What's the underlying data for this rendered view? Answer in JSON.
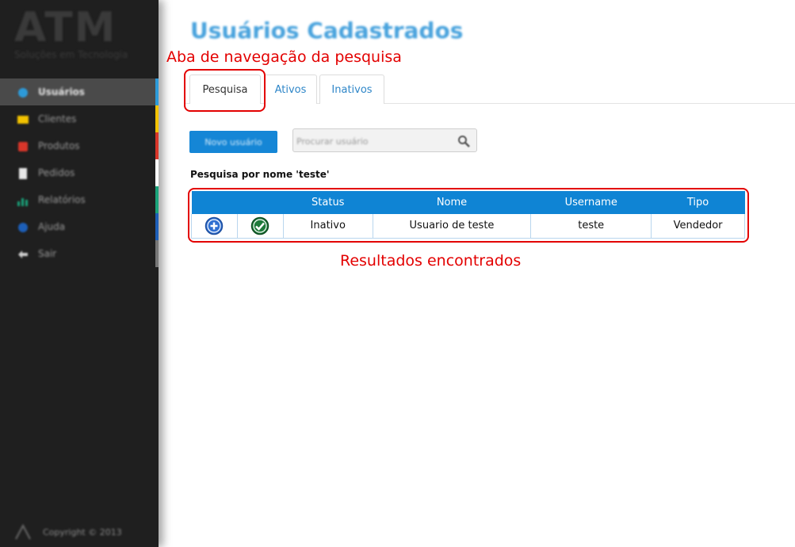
{
  "sidebar": {
    "logo": {
      "main": "ATM",
      "sub": "Soluções em Tecnologia"
    },
    "items": [
      {
        "label": "Usuários",
        "icon": "user-icon",
        "color": "#2d9ad9",
        "active": true
      },
      {
        "label": "Clientes",
        "icon": "card-icon",
        "color": "#f2c200",
        "active": false
      },
      {
        "label": "Produtos",
        "icon": "box-icon",
        "color": "#d9362a",
        "active": false
      },
      {
        "label": "Pedidos",
        "icon": "document-icon",
        "color": "#ffffff",
        "active": false
      },
      {
        "label": "Relatórios",
        "icon": "chart-icon",
        "color": "#1aa37a",
        "active": false
      },
      {
        "label": "Ajuda",
        "icon": "help-icon",
        "color": "#1d5fb8",
        "active": false
      },
      {
        "label": "Sair",
        "icon": "exit-icon",
        "color": "#777777",
        "active": false
      }
    ],
    "footer": "Copyright © 2013"
  },
  "main": {
    "title": "Usuários Cadastrados",
    "tabs": [
      {
        "label": "Pesquisa",
        "active": true
      },
      {
        "label": "Ativos",
        "active": false
      },
      {
        "label": "Inativos",
        "active": false
      }
    ],
    "new_user_button": "Novo usuário",
    "search": {
      "placeholder": "Procurar usuário"
    },
    "search_label": "Pesquisa por nome 'teste'",
    "table": {
      "headers": [
        "",
        "",
        "Status",
        "Nome",
        "Username",
        "Tipo"
      ],
      "rows": [
        {
          "status": "Inativo",
          "nome": "Usuario de teste",
          "username": "teste",
          "tipo": "Vendedor"
        }
      ]
    }
  },
  "annotations": {
    "tabs": "Aba de navegação da pesquisa",
    "results": "Resultados encontrados"
  },
  "colors": {
    "accent": "#0f84d4",
    "title": "#49a3dd",
    "annotation": "#e30000",
    "sidebar_bg": "#1f1f1f",
    "status_ok": "#1e7a3a"
  }
}
